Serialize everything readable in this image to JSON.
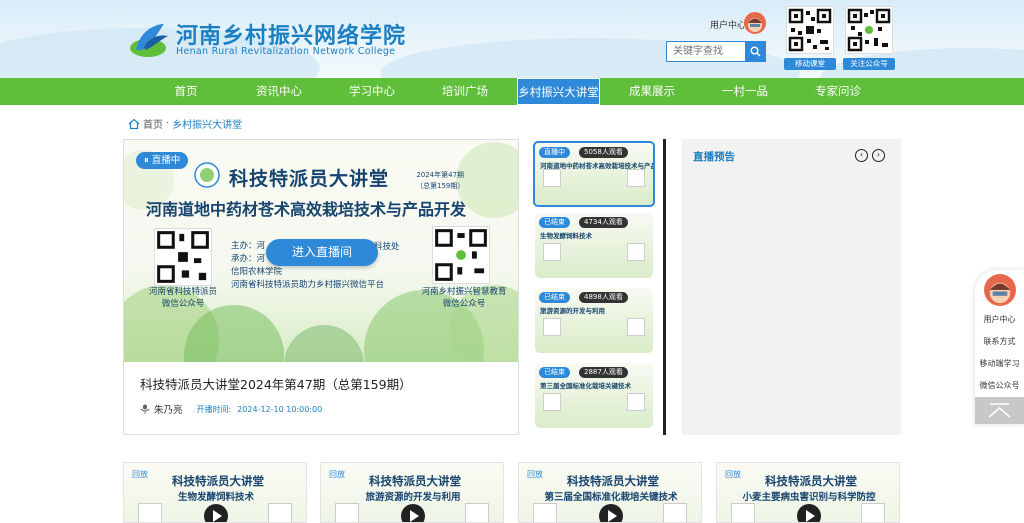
{
  "header": {
    "title": "河南乡村振兴网络学院",
    "subtitle": "Henan Rural Revitalization Network College",
    "user_center": "用户中心",
    "search_placeholder": "关键字查找",
    "qr_codes": [
      {
        "label": "移动课堂"
      },
      {
        "label": "关注公众号"
      }
    ]
  },
  "nav": {
    "items": [
      {
        "label": "首页"
      },
      {
        "label": "资讯中心"
      },
      {
        "label": "学习中心"
      },
      {
        "label": "培训广场"
      },
      {
        "label": "乡村振兴大讲堂",
        "active": true
      },
      {
        "label": "成果展示"
      },
      {
        "label": "一村一品"
      },
      {
        "label": "专家问诊"
      }
    ]
  },
  "breadcrumb": {
    "home": "首页",
    "separator": "·",
    "current": "乡村振兴大讲堂"
  },
  "main": {
    "status_badge": "直播中",
    "poster_title": "科技特派员大讲堂",
    "poster_issue_1": "2024年第47期",
    "poster_issue_2": "（总第159期）",
    "poster_subtitle": "河南道地中药材苍术高效栽培技术与产品开发",
    "poster_info_lines": [
      "主办：河",
      "承办：河",
      "信阳农林学院",
      "河南省科技特派员助力乡村振兴微信平台"
    ],
    "poster_info_suffix": "科技处",
    "qr_left_caption_1": "河南省科技特派员",
    "qr_left_caption_2": "微信公众号",
    "qr_right_caption_1": "河南乡村振兴智慧教育",
    "qr_right_caption_2": "微信公众号",
    "enter_button": "进入直播间",
    "title": "科技特派员大讲堂2024年第47期（总第159期）",
    "speaker": "朱乃亮",
    "time_label": "开播时间:",
    "time_value": "2024-12-10 10:00:00"
  },
  "side_list": [
    {
      "status": "直播中",
      "views": "5058人观看",
      "title": "河南道地中药材苍术高效栽培技术与产品开发",
      "active": true
    },
    {
      "status": "已结束",
      "views": "4734人观看",
      "title": "生物发酵饲料技术",
      "active": false
    },
    {
      "status": "已结束",
      "views": "4898人观看",
      "title": "旅游资源的开发与利用",
      "active": false
    },
    {
      "status": "已结束",
      "views": "2887人观看",
      "title": "第三届全国标准化栽培关键技术",
      "active": false
    }
  ],
  "preview": {
    "title": "直播预告"
  },
  "float_bar": {
    "items": [
      "用户中心",
      "联系方式",
      "移动端学习",
      "微信公众号"
    ]
  },
  "cards": [
    {
      "tag": "回放",
      "title": "科技特派员大讲堂",
      "subtitle": "生物发酵饲料技术"
    },
    {
      "tag": "回放",
      "title": "科技特派员大讲堂",
      "subtitle": "旅游资源的开发与利用"
    },
    {
      "tag": "回放",
      "title": "科技特派员大讲堂",
      "subtitle": "第三届全国标准化栽培关键技术"
    },
    {
      "tag": "回放",
      "title": "科技特派员大讲堂",
      "subtitle": "小麦主要病虫害识别与科学防控"
    }
  ],
  "colors": {
    "nav_green": "#5fbe3a",
    "accent_blue": "#2e8ad8",
    "title_blue": "#1b7fc4"
  }
}
